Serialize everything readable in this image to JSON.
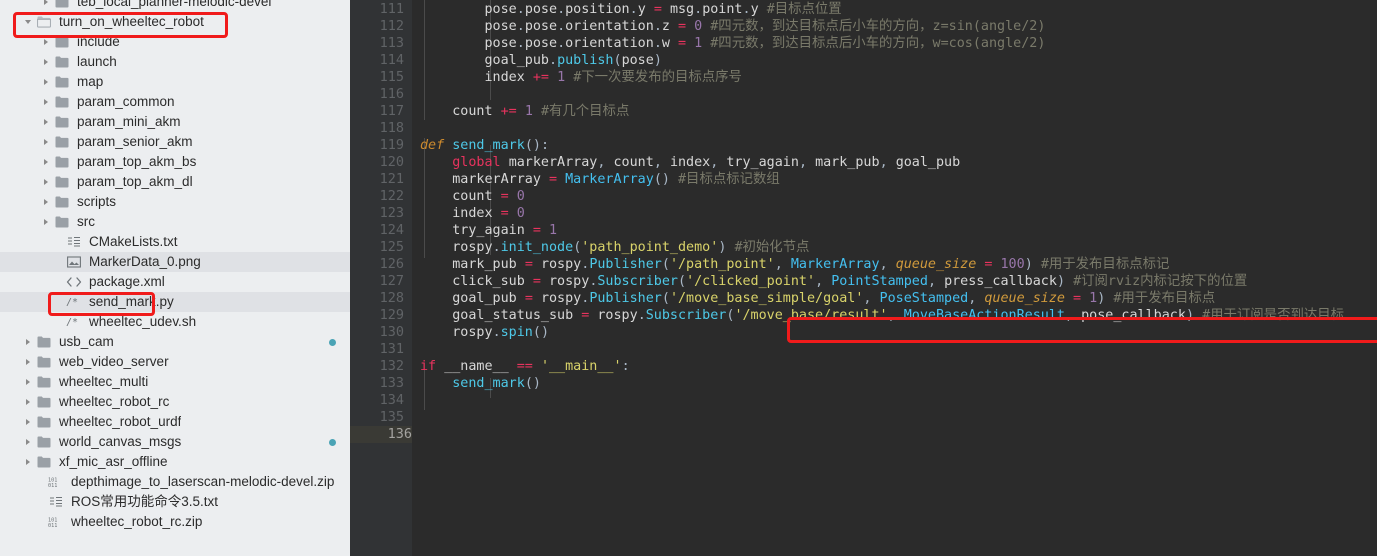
{
  "sidebar": {
    "name": "project-file-tree",
    "items": [
      {
        "label": "teb_local_planner-melodic-devel",
        "icon": "folder-icon",
        "twisty": "right",
        "indent": 2,
        "alt": false,
        "dot": false,
        "clipped_top": true
      },
      {
        "label": "turn_on_wheeltec_robot",
        "icon": "folder-open-icon",
        "twisty": "down",
        "indent": 1,
        "alt": false,
        "dot": false,
        "highlighted": true
      },
      {
        "label": "include",
        "icon": "folder-icon",
        "twisty": "right",
        "indent": 2,
        "alt": false,
        "dot": false
      },
      {
        "label": "launch",
        "icon": "folder-icon",
        "twisty": "right",
        "indent": 2,
        "alt": false,
        "dot": false
      },
      {
        "label": "map",
        "icon": "folder-icon",
        "twisty": "right",
        "indent": 2,
        "alt": false,
        "dot": false
      },
      {
        "label": "param_common",
        "icon": "folder-icon",
        "twisty": "right",
        "indent": 2,
        "alt": false,
        "dot": false
      },
      {
        "label": "param_mini_akm",
        "icon": "folder-icon",
        "twisty": "right",
        "indent": 2,
        "alt": false,
        "dot": false
      },
      {
        "label": "param_senior_akm",
        "icon": "folder-icon",
        "twisty": "right",
        "indent": 2,
        "alt": false,
        "dot": false
      },
      {
        "label": "param_top_akm_bs",
        "icon": "folder-icon",
        "twisty": "right",
        "indent": 2,
        "alt": false,
        "dot": false
      },
      {
        "label": "param_top_akm_dl",
        "icon": "folder-icon",
        "twisty": "right",
        "indent": 2,
        "alt": false,
        "dot": false
      },
      {
        "label": "scripts",
        "icon": "folder-icon",
        "twisty": "right",
        "indent": 2,
        "alt": false,
        "dot": false
      },
      {
        "label": "src",
        "icon": "folder-icon",
        "twisty": "right",
        "indent": 2,
        "alt": false,
        "dot": false
      },
      {
        "label": "CMakeLists.txt",
        "icon": "text-file-icon",
        "twisty": "none",
        "indent": 2,
        "alt": false,
        "dot": false
      },
      {
        "label": "MarkerData_0.png",
        "icon": "image-file-icon",
        "twisty": "none",
        "indent": 2,
        "alt": true,
        "dot": false
      },
      {
        "label": "package.xml",
        "icon": "xml-file-icon",
        "twisty": "none",
        "indent": 2,
        "alt": false,
        "dot": false
      },
      {
        "label": "send_mark.py",
        "icon": "script-file-icon",
        "twisty": "none",
        "indent": 2,
        "alt": true,
        "dot": false,
        "highlighted": true
      },
      {
        "label": "wheeltec_udev.sh",
        "icon": "script-file-icon",
        "twisty": "none",
        "indent": 2,
        "alt": false,
        "dot": false
      },
      {
        "label": "usb_cam",
        "icon": "folder-icon",
        "twisty": "right",
        "indent": 1,
        "alt": false,
        "dot": true
      },
      {
        "label": "web_video_server",
        "icon": "folder-icon",
        "twisty": "right",
        "indent": 1,
        "alt": false,
        "dot": false
      },
      {
        "label": "wheeltec_multi",
        "icon": "folder-icon",
        "twisty": "right",
        "indent": 1,
        "alt": false,
        "dot": false
      },
      {
        "label": "wheeltec_robot_rc",
        "icon": "folder-icon",
        "twisty": "right",
        "indent": 1,
        "alt": false,
        "dot": false
      },
      {
        "label": "wheeltec_robot_urdf",
        "icon": "folder-icon",
        "twisty": "right",
        "indent": 1,
        "alt": false,
        "dot": false
      },
      {
        "label": "world_canvas_msgs",
        "icon": "folder-icon",
        "twisty": "right",
        "indent": 1,
        "alt": false,
        "dot": true
      },
      {
        "label": "xf_mic_asr_offline",
        "icon": "folder-icon",
        "twisty": "right",
        "indent": 1,
        "alt": false,
        "dot": false
      },
      {
        "label": "depthimage_to_laserscan-melodic-devel.zip",
        "icon": "binary-file-icon",
        "twisty": "none",
        "indent": 1,
        "alt": false,
        "dot": false
      },
      {
        "label": "ROS常用功能命令3.5.txt",
        "icon": "text-file-icon",
        "twisty": "none",
        "indent": 1,
        "alt": false,
        "dot": false
      },
      {
        "label": "wheeltec_robot_rc.zip",
        "icon": "binary-file-icon",
        "twisty": "none",
        "indent": 1,
        "alt": false,
        "dot": false
      }
    ]
  },
  "editor": {
    "name": "code-editor",
    "first_line_number": 111,
    "current_line_number": 136,
    "line_numbers": [
      111,
      112,
      113,
      114,
      115,
      116,
      117,
      118,
      119,
      120,
      121,
      122,
      123,
      124,
      125,
      126,
      127,
      128,
      129,
      130,
      131,
      132,
      133,
      134,
      135,
      136
    ],
    "lines": [
      {
        "n": 111,
        "text": "        pose.pose.position.y = msg.point.y #目标点位置"
      },
      {
        "n": 112,
        "text": "        pose.pose.orientation.z = 0 #四元数，到达目标点后小车的方向，z=sin(angle/2)"
      },
      {
        "n": 113,
        "text": "        pose.pose.orientation.w = 1 #四元数，到达目标点后小车的方向，w=cos(angle/2)"
      },
      {
        "n": 114,
        "text": "        goal_pub.publish(pose)"
      },
      {
        "n": 115,
        "text": "        index += 1 #下一次要发布的目标点序号"
      },
      {
        "n": 116,
        "text": ""
      },
      {
        "n": 117,
        "text": "    count += 1 #有几个目标点"
      },
      {
        "n": 118,
        "text": ""
      },
      {
        "n": 119,
        "text": "def send_mark():"
      },
      {
        "n": 120,
        "text": "    global markerArray, count, index, try_again, mark_pub, goal_pub"
      },
      {
        "n": 121,
        "text": "    markerArray = MarkerArray() #目标点标记数组"
      },
      {
        "n": 122,
        "text": "    count = 0"
      },
      {
        "n": 123,
        "text": "    index = 0"
      },
      {
        "n": 124,
        "text": "    try_again = 1"
      },
      {
        "n": 125,
        "text": "    rospy.init_node('path_point_demo') #初始化节点"
      },
      {
        "n": 126,
        "text": "    mark_pub = rospy.Publisher('/path_point', MarkerArray, queue_size = 100) #用于发布目标点标记"
      },
      {
        "n": 127,
        "text": "    click_sub = rospy.Subscriber('/clicked_point', PointStamped, press_callback) #订阅rviz内标记按下的位置"
      },
      {
        "n": 128,
        "text": "    goal_pub = rospy.Publisher('/move_base_simple/goal', PoseStamped, queue_size = 1) #用于发布目标点"
      },
      {
        "n": 129,
        "text": "    goal_status_sub = rospy.Subscriber('/move_base/result', MoveBaseActionResult, pose_callback) #用于订阅是否到达目标"
      },
      {
        "n": 130,
        "text": "    rospy.spin()"
      },
      {
        "n": 131,
        "text": ""
      },
      {
        "n": 132,
        "text": "if __name__ == '__main__':"
      },
      {
        "n": 133,
        "text": "    send_mark()"
      },
      {
        "n": 134,
        "text": ""
      },
      {
        "n": 135,
        "text": ""
      },
      {
        "n": 136,
        "text": ""
      }
    ]
  },
  "annotations": [
    {
      "name": "highlight-box-turn-on-wheeltec-robot",
      "target": "turn_on_wheeltec_robot"
    },
    {
      "name": "highlight-box-send-mark-py",
      "target": "send_mark.py"
    },
    {
      "name": "highlight-box-goal-status-sub-line",
      "target": "line 129 goal_status_sub"
    }
  ],
  "colors": {
    "annotation_red": "#f01b1b",
    "sidebar_bg": "#eceef0",
    "sidebar_row_alt": "#dfe1e5",
    "editor_bg": "#2b2b2b",
    "gutter_bg": "#313335",
    "vcs_dot_teal": "#4aa3b5"
  }
}
